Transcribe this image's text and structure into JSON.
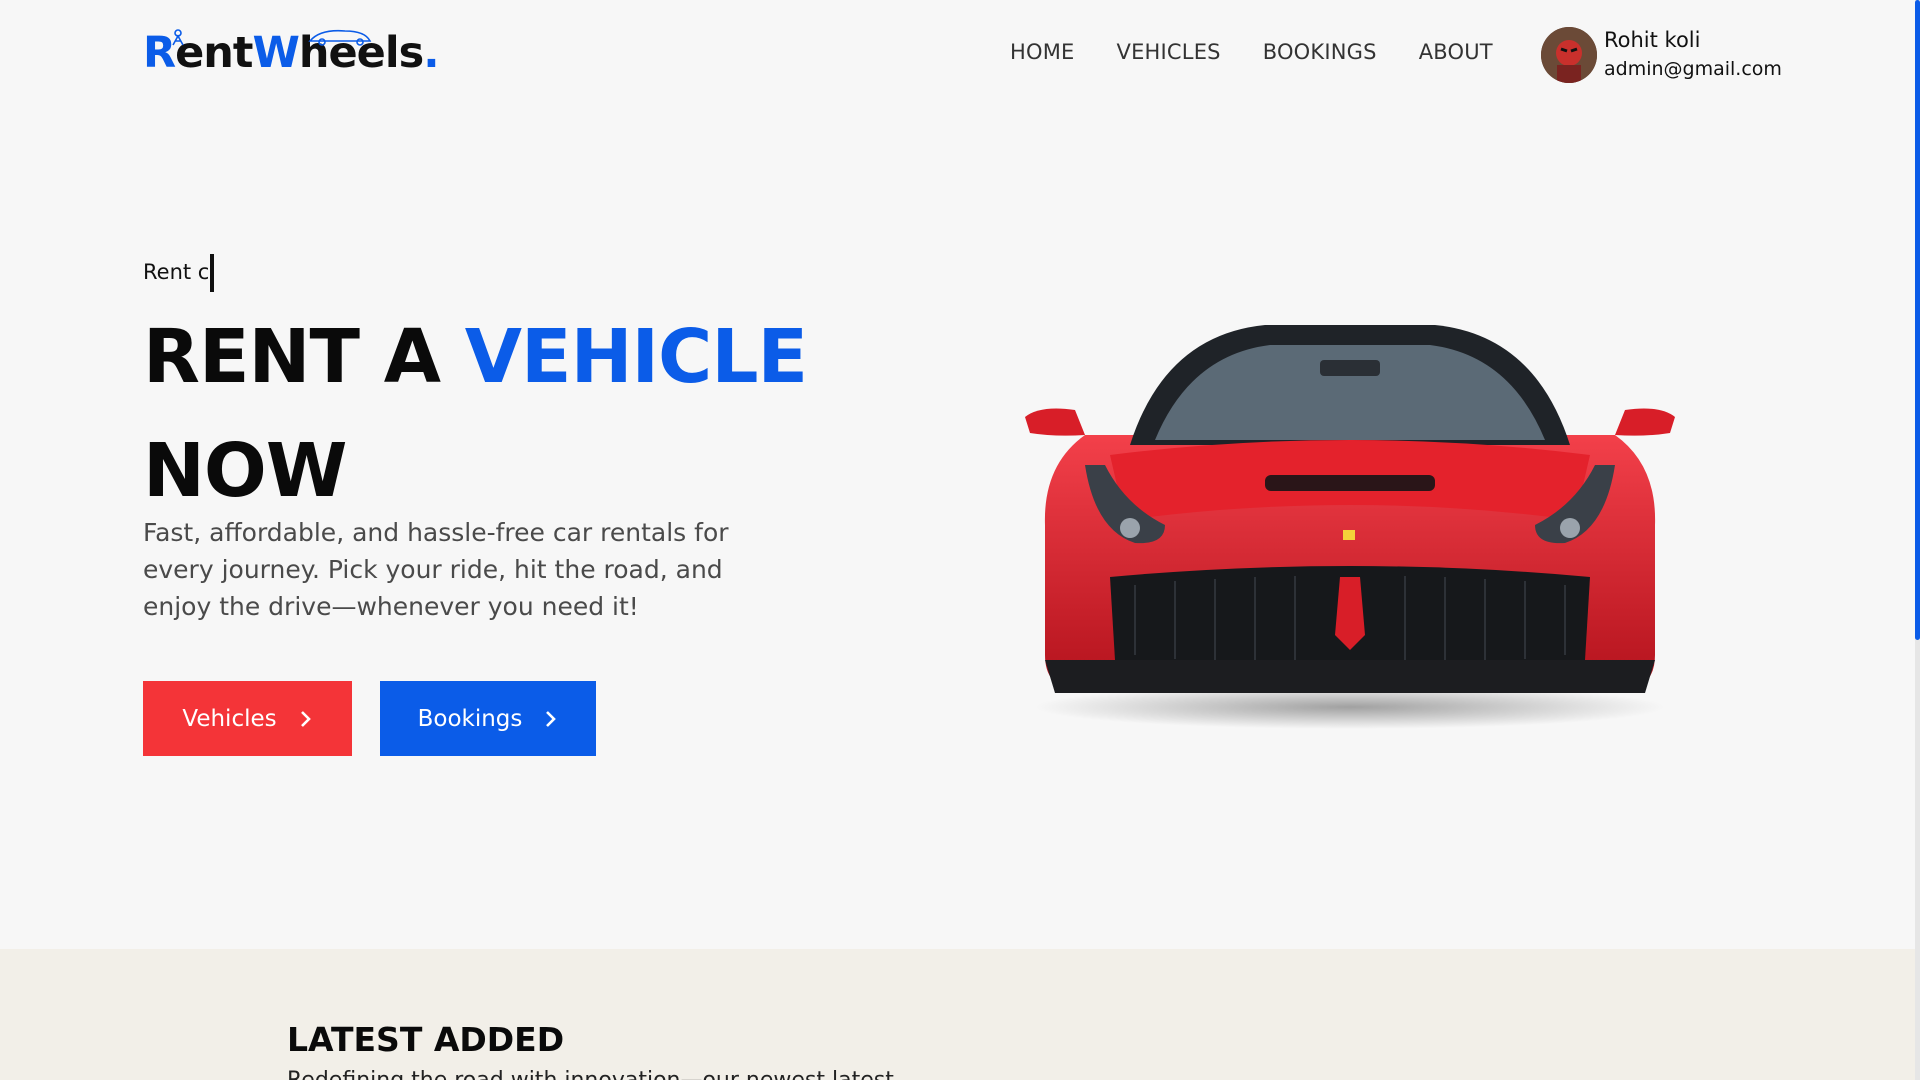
{
  "brand": {
    "part1": "R",
    "part2": "ent",
    "part3": "W",
    "part4": "heels",
    "dot": "."
  },
  "nav": {
    "items": [
      {
        "label": "HOME"
      },
      {
        "label": "VEHICLES"
      },
      {
        "label": "BOOKINGS"
      },
      {
        "label": "ABOUT"
      }
    ]
  },
  "user": {
    "name": "Rohit koli",
    "email": "admin@gmail.com"
  },
  "hero": {
    "typed_text": "Rent c",
    "title_part1": "RENT A ",
    "title_accent": "VEHICLE",
    "title_part2": "NOW",
    "description": "Fast, affordable, and hassle-free car rentals for every journey. Pick your ride, hit the road, and enjoy the drive—whenever you need it!",
    "buttons": {
      "vehicles": "Vehicles",
      "bookings": "Bookings"
    }
  },
  "latest": {
    "title": "LATEST ADDED",
    "subtitle": "Redefining the road with innovation—our newest latest"
  },
  "colors": {
    "accent": "#0b5ce8",
    "red": "#f43438",
    "section_bg": "#f2efe8"
  }
}
